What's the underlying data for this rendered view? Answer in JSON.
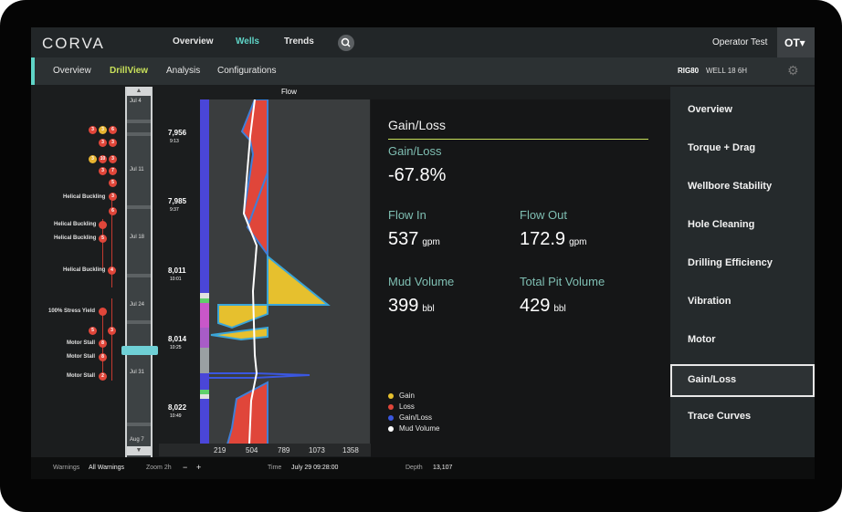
{
  "app": {
    "logo": "CORVA"
  },
  "topnav": {
    "items": [
      "Overview",
      "Wells",
      "Trends"
    ],
    "active": "Wells",
    "user_name": "Operator Test",
    "user_initials": "OT▾"
  },
  "subnav": {
    "items": [
      "Overview",
      "DrillView",
      "Analysis",
      "Configurations"
    ],
    "active": "DrillView",
    "rig": "RIG80",
    "well": "WELL 18 6H"
  },
  "timeline": {
    "events": [
      {
        "label": "Helical Buckling"
      },
      {
        "label": "Helical Buckling"
      },
      {
        "label": "Helical Buckling"
      },
      {
        "label": "Helical Buckling"
      },
      {
        "label": "100% Stress Yield"
      },
      {
        "label": "Motor Stall"
      },
      {
        "label": "Motor Stall"
      },
      {
        "label": "Motor Stall"
      }
    ],
    "badges": [
      "3",
      "3",
      "6",
      "3",
      "3",
      "3",
      "10",
      "3",
      "3",
      "7",
      "5",
      "3",
      "6",
      "5",
      "4",
      "5",
      "3",
      "8",
      "8",
      "2"
    ],
    "dates": [
      "Jul 4",
      "Jul 11",
      "Jul 18",
      "Jul 24",
      "Jul 31",
      "Aug 7"
    ]
  },
  "depths": [
    {
      "depth": "7,956",
      "time": "9:13"
    },
    {
      "depth": "7,985",
      "time": "9:37"
    },
    {
      "depth": "8,011",
      "time": "10:01"
    },
    {
      "depth": "8,014",
      "time": "10:25"
    },
    {
      "depth": "8,022",
      "time": "10:49"
    }
  ],
  "flow": {
    "title": "Flow",
    "ticks": [
      "219",
      "504",
      "789",
      "1073",
      "1358"
    ]
  },
  "panel": {
    "title": "Gain/Loss",
    "gain_loss": {
      "label": "Gain/Loss",
      "value": "-67.8%"
    },
    "flow_in": {
      "label": "Flow In",
      "value": "537",
      "unit": "gpm"
    },
    "flow_out": {
      "label": "Flow Out",
      "value": "172.9",
      "unit": "gpm"
    },
    "mud_volume": {
      "label": "Mud Volume",
      "value": "399",
      "unit": "bbl"
    },
    "total_pit_volume": {
      "label": "Total Pit Volume",
      "value": "429",
      "unit": "bbl"
    },
    "legend": [
      {
        "label": "Gain",
        "color": "#e6c02e"
      },
      {
        "label": "Loss",
        "color": "#e0463a"
      },
      {
        "label": "Gain/Loss",
        "color": "#3a57e0"
      },
      {
        "label": "Mud Volume",
        "color": "#ffffff"
      }
    ]
  },
  "menu": {
    "items": [
      "Overview",
      "Torque + Drag",
      "Wellbore Stability",
      "Hole Cleaning",
      "Drilling Efficiency",
      "Vibration",
      "Motor",
      "Gain/Loss",
      "Trace Curves"
    ],
    "active": "Gain/Loss"
  },
  "status": {
    "warnings_label": "Warnings",
    "warnings_value": "All Warnings",
    "zoom_label": "Zoom 2h",
    "zoom_minus": "−",
    "zoom_plus": "+",
    "time_label": "Time",
    "time_value": "July 29 09:28:00",
    "depth_label": "Depth",
    "depth_value": "13,107"
  }
}
